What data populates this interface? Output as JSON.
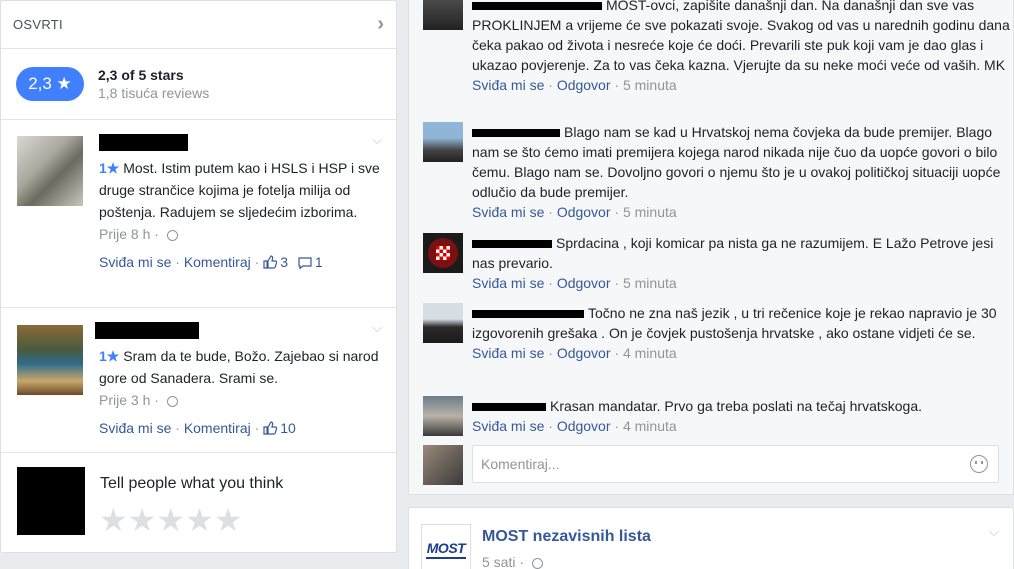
{
  "reviews": {
    "title": "OSVRTI",
    "rating": {
      "pill": "2,3 ★",
      "summary": "2,3 of 5 stars",
      "count": "1,8 tisuća reviews"
    },
    "items": [
      {
        "star": "1★",
        "text": " Most. Istim putem kao i HSLS i HSP i sve druge strančice kojima je fotelja milija od poštenja. Radujem se sljedećim izborima.",
        "time": "Prije 8 h · ",
        "like_label": "Sviđa mi se",
        "comment_label": "Komentiraj",
        "like_count": "3",
        "comment_count": "1"
      },
      {
        "star": "1★",
        "text": " Sram da te bude, Božo. Zajebao si narod gore od Sanadera. Srami se.",
        "time": "Prije 3 h · ",
        "like_label": "Sviđa mi se",
        "comment_label": "Komentiraj",
        "like_count": "10"
      }
    ],
    "tell": {
      "prompt": "Tell people what you think",
      "stars": "★★★★★"
    }
  },
  "comments": [
    {
      "text": "MOST-ovci, zapišite današnji dan. Na današnji dan sve vas PROKLINJEM a vrijeme će sve pokazati svoje. Svakog od vas u narednih godinu dana čeka pakao od života i nesreće koje će doći. Prevarili ste puk koji vam je dao glas i ukazao povjerenje. Za to vas čeka kazna. Vjerujte da su neke moći veće od vaših. MK",
      "like": "Sviđa mi se",
      "reply": "Odgovor",
      "time": "5 minuta"
    },
    {
      "text": "Blago nam se kad u Hrvatskoj nema čovjeka da bude premijer. Blago nam se što ćemo imati premijera kojega narod nikada nije čuo da uopće govori o bilo čemu. Blago nam se. Dovoljno govori o njemu što je u ovakoj političkoj situaciji uopće odlučio da bude premijer.",
      "like": "Sviđa mi se",
      "reply": "Odgovor",
      "time": "5 minuta"
    },
    {
      "text": "Sprdacina , koji komicar pa nista ga ne razumijem. E Lažo Petrove jesi nas prevario.",
      "like": "Sviđa mi se",
      "reply": "Odgovor",
      "time": "5 minuta"
    },
    {
      "text": "Točno ne zna naš jezik , u tri rečenice koje je rekao napravio je 30 izgovorenih grešaka . On je čovjek pustošenja hrvatske , ako ostane vidjeti će se.",
      "like": "Sviđa mi se",
      "reply": "Odgovor",
      "time": "4 minuta"
    },
    {
      "text": "Krasan mandatar. Prvo ga treba poslati na tečaj hrvatskoga.",
      "like": "Sviđa mi se",
      "reply": "Odgovor",
      "time": "4 minuta"
    }
  ],
  "compose": {
    "placeholder": "Komentiraj..."
  },
  "post2": {
    "page_name": "MOST nezavisnih lista",
    "time": "5 sati · ",
    "logo_text": "MOST"
  },
  "colors": {
    "accent": "#4080ff",
    "link": "#365899",
    "muted": "#90949c"
  }
}
